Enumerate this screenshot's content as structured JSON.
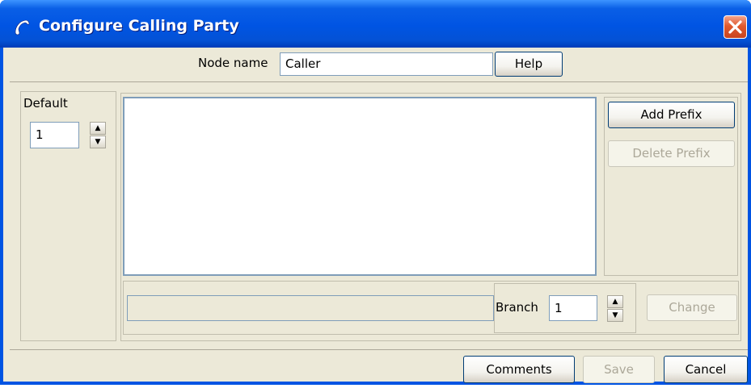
{
  "window": {
    "title": "Configure Calling Party",
    "title_icon": "phone-handset-icon",
    "close_icon": "close-icon"
  },
  "node": {
    "label": "Node name",
    "value": "Caller",
    "help_label": "Help"
  },
  "default_panel": {
    "label": "Default",
    "value": "1",
    "up_icon": "spin-up-icon",
    "down_icon": "spin-down-icon"
  },
  "prefix": {
    "add_label": "Add Prefix",
    "delete_label": "Delete Prefix",
    "delete_enabled": false
  },
  "branch": {
    "field_value": "",
    "label": "Branch",
    "value": "1",
    "change_label": "Change",
    "change_enabled": false
  },
  "footer": {
    "comments_label": "Comments",
    "save_label": "Save",
    "save_enabled": false,
    "cancel_label": "Cancel"
  },
  "colors": {
    "titlebar": "#0054e3",
    "client_bg": "#ece9d8",
    "close_button": "#e05a2e",
    "disabled_text": "#aca899"
  }
}
